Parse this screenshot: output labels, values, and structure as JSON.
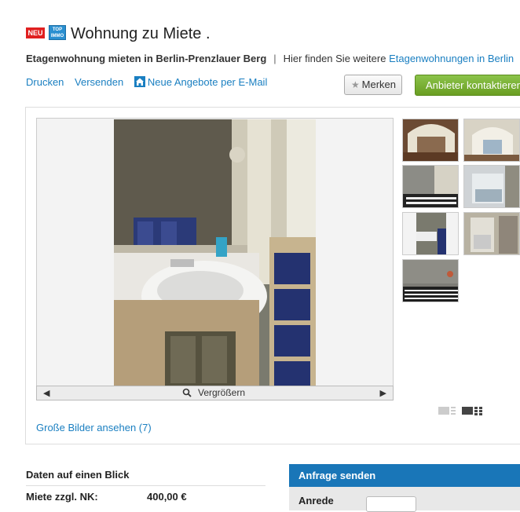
{
  "listing": {
    "badge_new": "NEU",
    "badge_top": "TOP IMMO",
    "title": "Wohnung zu Miete .",
    "subtitle_bold": "Etagenwohnung mieten in Berlin-Prenzlauer Berg",
    "subtitle_separator": "|",
    "subtitle_text": "Hier finden Sie weitere",
    "subtitle_link": "Etagenwohnungen in Berlin"
  },
  "actions": {
    "print": "Drucken",
    "send": "Versenden",
    "email_alert": "Neue Angebote per E-Mail",
    "merken": "Merken",
    "contact": "Anbieter kontaktieren"
  },
  "gallery": {
    "zoom_label": "Vergrößern",
    "large_images_link": "Große Bilder ansehen (7)",
    "thumbnail_count": 7
  },
  "details": {
    "section_title": "Daten auf einen Blick",
    "rows": [
      {
        "label": "Miete zzgl. NK:",
        "value": "400,00 €"
      }
    ]
  },
  "inquiry": {
    "header": "Anfrage senden",
    "anrede_label": "Anrede"
  },
  "colors": {
    "link": "#1a7fc1",
    "contact_button": "#7cb342",
    "inquiry_header": "#1976b8",
    "badge_new": "#e02020",
    "badge_top": "#2a8fd0"
  }
}
